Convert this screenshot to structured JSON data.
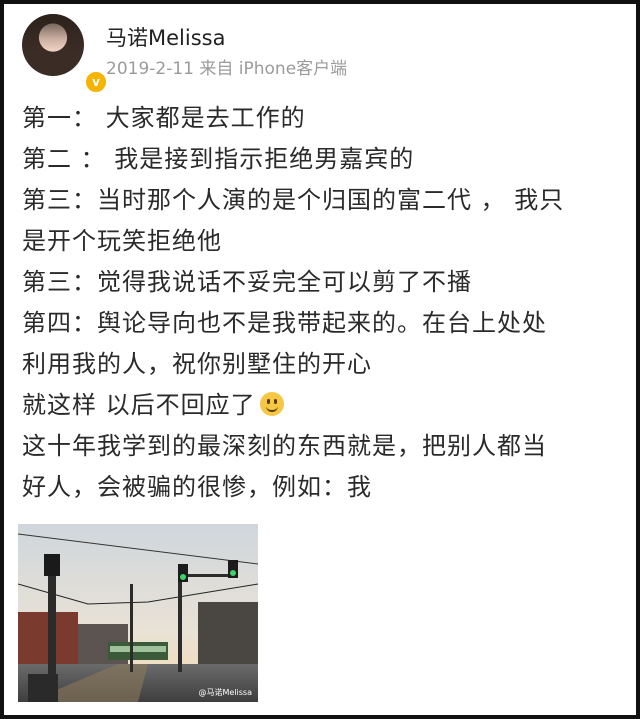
{
  "post": {
    "username": "马诺Melissa",
    "meta": "2019-2-11 来自 iPhone客户端",
    "verified_badge": "v",
    "lines": [
      "第一： 大家都是去工作的",
      "第二 ： 我是接到指示拒绝男嘉宾的",
      "第三：当时那个人演的是个归国的富二代 ， 我只",
      "是开个玩笑拒绝他",
      "第三：觉得我说话不妥完全可以剪了不播",
      "第四：舆论导向也不是我带起来的。在台上处处",
      "利用我的人，祝你别墅住的开心",
      "就这样 以后不回应了",
      "这十年我学到的最深刻的东西就是，把别人都当",
      "好人，会被骗的很惨，例如：我"
    ],
    "emoji_icon": "smile-emoji",
    "photo_watermark": "@马诺Melissa"
  },
  "colors": {
    "username": "#222222",
    "meta": "#9b9b9b",
    "text": "#2a2a2a",
    "badge": "#f4b400"
  }
}
